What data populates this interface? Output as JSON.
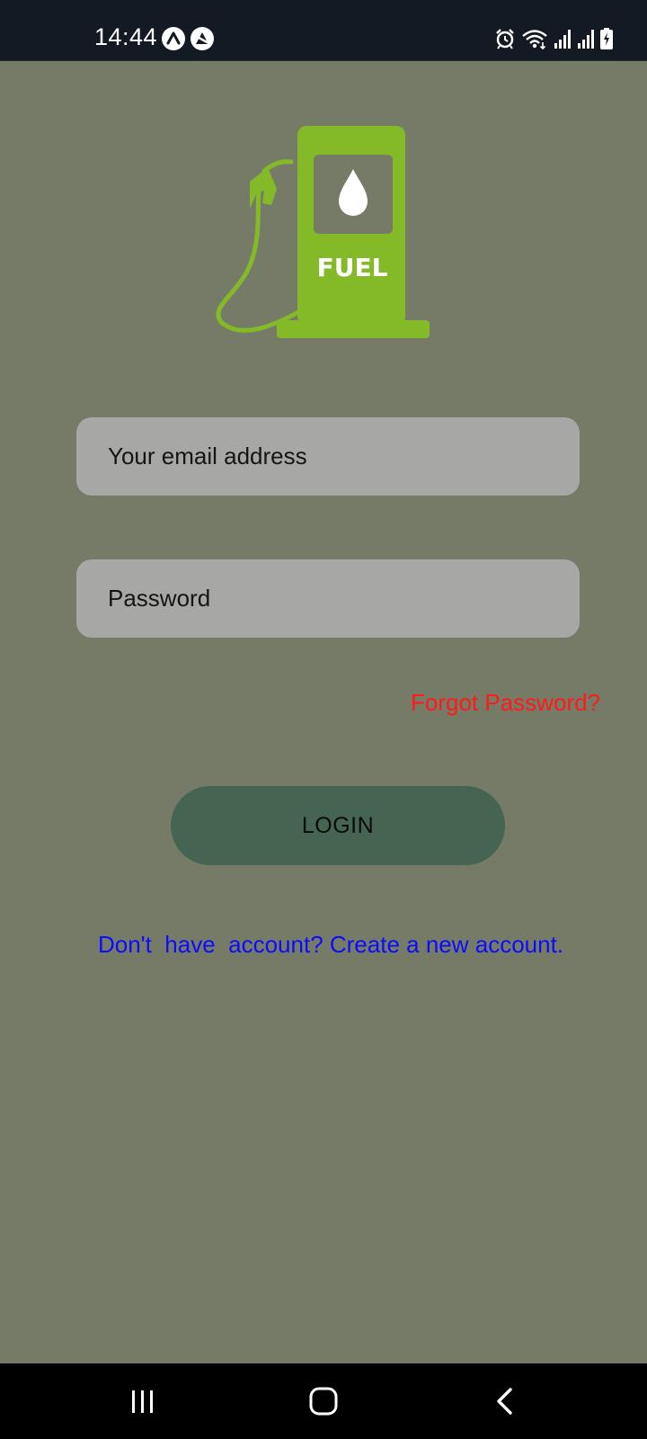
{
  "status_bar": {
    "time": "14:44",
    "notification_icons": [
      "app-icon-a",
      "app-icon-b"
    ],
    "system_icons": [
      "alarm-icon",
      "wifi-icon",
      "signal-icon",
      "signal-icon",
      "battery-charging-icon"
    ]
  },
  "logo": {
    "text": "FUEL",
    "color": "#84b928"
  },
  "form": {
    "email_placeholder": "Your email address",
    "email_value": "",
    "password_placeholder": "Password",
    "password_value": "",
    "forgot_label": "Forgot Password?",
    "login_label": "LOGIN",
    "signup_label": "Don't  have  account? Create a new account."
  },
  "colors": {
    "background": "#767b68",
    "input_background": "#a7a7a5",
    "login_button": "#456452",
    "forgot_text": "#ff1a1a",
    "signup_text": "#0b0bff",
    "status_bar": "#141a24"
  },
  "nav_bar": {
    "buttons": [
      "recent-apps-icon",
      "home-icon",
      "back-icon"
    ]
  }
}
